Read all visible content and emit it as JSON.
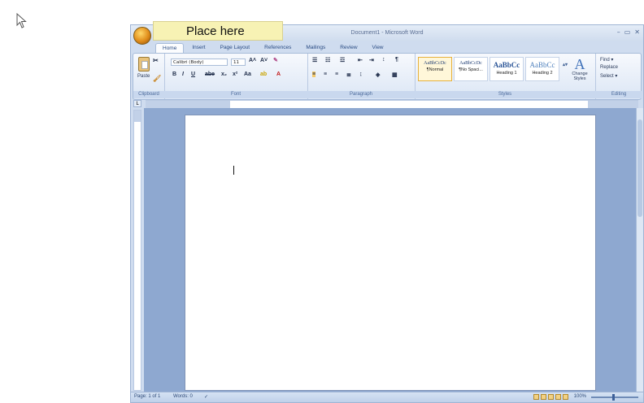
{
  "callout": {
    "text": "Place here"
  },
  "window": {
    "title": "Document1 - Microsoft Word",
    "controls": [
      "–",
      "▭",
      "✕"
    ]
  },
  "tabs": [
    "Home",
    "Insert",
    "Page Layout",
    "References",
    "Mailings",
    "Review",
    "View"
  ],
  "ribbon": {
    "clipboard": {
      "label": "Clipboard",
      "paste": "Paste"
    },
    "font": {
      "label": "Font",
      "name": "Calibri (Body)",
      "size": "11"
    },
    "paragraph": {
      "label": "Paragraph"
    },
    "styles": {
      "label": "Styles",
      "items": [
        {
          "sample": "AaBbCcDc",
          "name": "¶Normal"
        },
        {
          "sample": "AaBbCcDc",
          "name": "¶No Spaci..."
        },
        {
          "sample": "AaBbCc",
          "name": "Heading 1"
        },
        {
          "sample": "AaBbCc",
          "name": "Heading 2"
        }
      ],
      "change": "Change Styles"
    },
    "editing": {
      "label": "Editing",
      "items": [
        "Find ▾",
        "Replace",
        "Select ▾"
      ]
    }
  },
  "status": {
    "page": "Page: 1 of 1",
    "words": "Words: 0",
    "zoom": "100%"
  },
  "icons": [
    "mouse-pointer-icon",
    "office-button-icon",
    "paste-icon",
    "change-styles-icon"
  ]
}
